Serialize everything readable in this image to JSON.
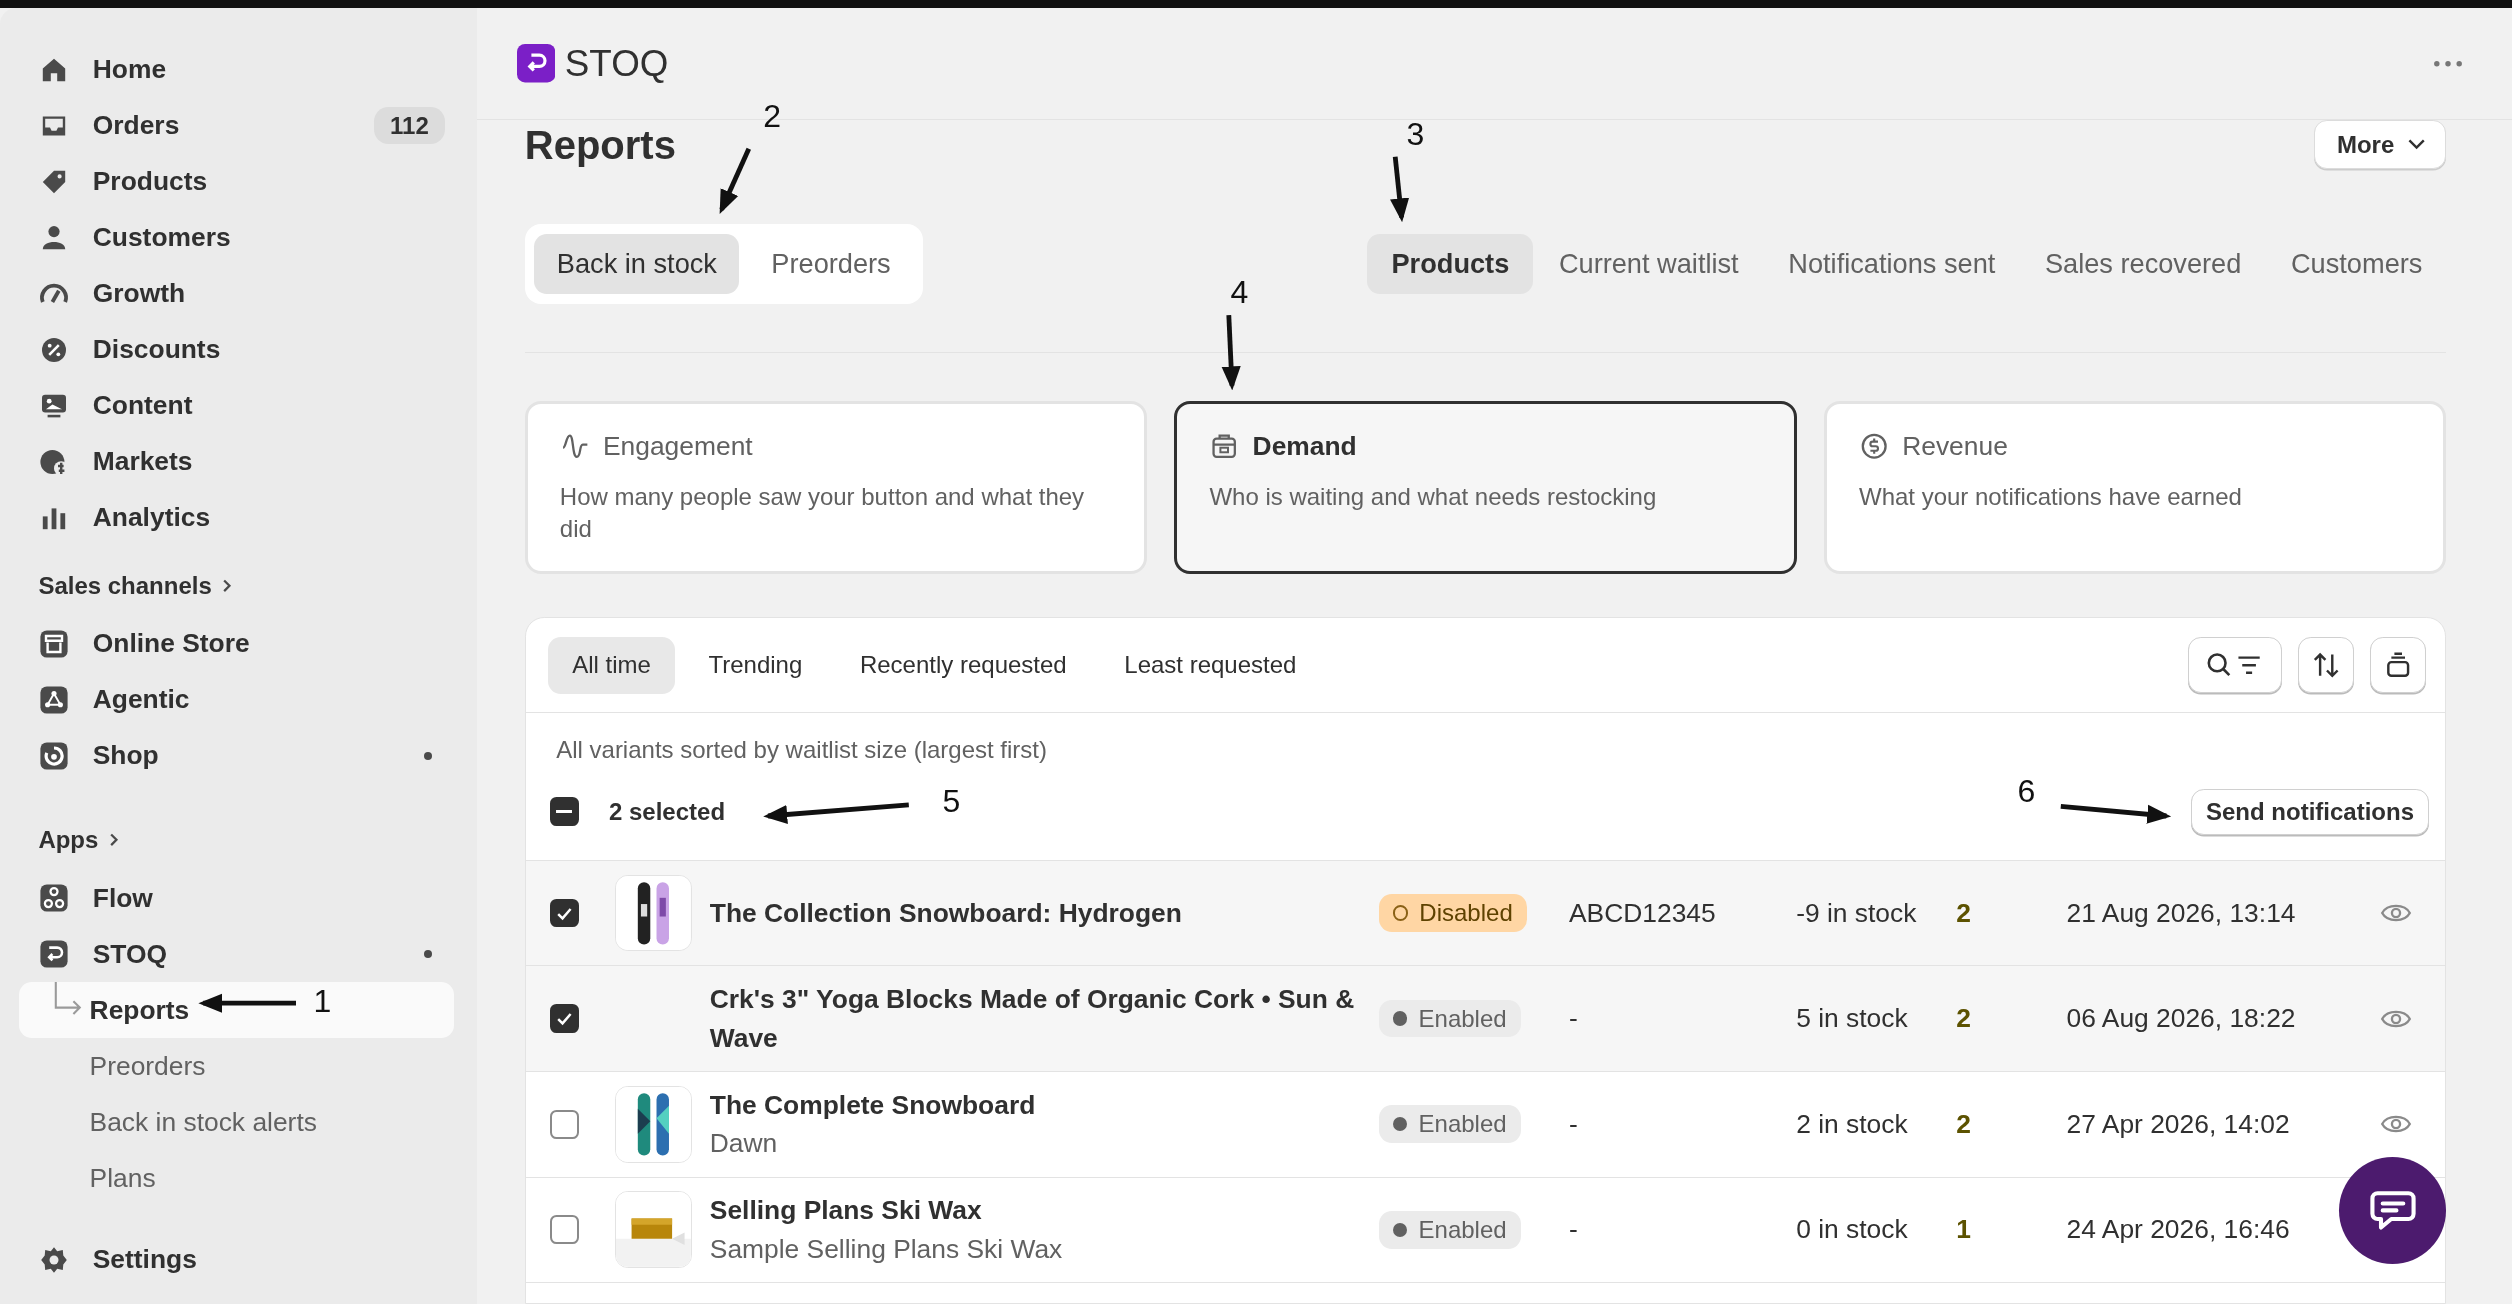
{
  "sidebar": {
    "main_items": [
      {
        "label": "Home"
      },
      {
        "label": "Orders",
        "badge": "112"
      },
      {
        "label": "Products"
      },
      {
        "label": "Customers"
      },
      {
        "label": "Growth"
      },
      {
        "label": "Discounts"
      },
      {
        "label": "Content"
      },
      {
        "label": "Markets"
      },
      {
        "label": "Analytics"
      }
    ],
    "sales_channels": {
      "heading": "Sales channels",
      "items": [
        {
          "label": "Online Store",
          "notification_dot": false
        },
        {
          "label": "Agentic",
          "notification_dot": false
        },
        {
          "label": "Shop",
          "notification_dot": true
        }
      ]
    },
    "apps": {
      "heading": "Apps",
      "items": [
        {
          "label": "Flow",
          "notification_dot": false
        },
        {
          "label": "STOQ",
          "notification_dot": true,
          "children": [
            {
              "label": "Reports",
              "selected": true
            },
            {
              "label": "Preorders",
              "selected": false
            },
            {
              "label": "Back in stock alerts",
              "selected": false
            },
            {
              "label": "Plans",
              "selected": false
            }
          ]
        }
      ]
    },
    "settings": {
      "label": "Settings"
    }
  },
  "header": {
    "app_name": "STOQ"
  },
  "page": {
    "title": "Reports",
    "more_button": "More"
  },
  "report_types": [
    {
      "label": "Back in stock",
      "selected": true
    },
    {
      "label": "Preorders",
      "selected": false
    }
  ],
  "view_tabs": [
    {
      "label": "Products",
      "selected": true
    },
    {
      "label": "Current waitlist",
      "selected": false
    },
    {
      "label": "Notifications sent",
      "selected": false
    },
    {
      "label": "Sales recovered",
      "selected": false
    },
    {
      "label": "Customers",
      "selected": false
    }
  ],
  "category_cards": [
    {
      "title": "Engagement",
      "description": "How many people saw your button and what they did",
      "selected": false
    },
    {
      "title": "Demand",
      "description": "Who is waiting and what needs restocking",
      "selected": true
    },
    {
      "title": "Revenue",
      "description": "What your notifications have earned",
      "selected": false
    }
  ],
  "table": {
    "filter_tabs": [
      {
        "label": "All time",
        "selected": true
      },
      {
        "label": "Trending",
        "selected": false
      },
      {
        "label": "Recently requested",
        "selected": false
      },
      {
        "label": "Least requested",
        "selected": false
      }
    ],
    "caption": "All variants sorted by waitlist size (largest first)",
    "selection": {
      "label": "2 selected",
      "indeterminate": true
    },
    "send_button": "Send notifications",
    "rows": [
      {
        "name": "The Collection Snowboard: Hydrogen",
        "status": {
          "label": "Disabled",
          "kind": "disabled"
        },
        "sku": "ABCD12345",
        "stock": "-9 in stock",
        "waitlist": "2",
        "date": "21 Aug 2026, 13:14",
        "selected": true
      },
      {
        "name": "Crk's 3\" Yoga Blocks Made of Organic Cork • Sun & Wave",
        "status": {
          "label": "Enabled",
          "kind": "enabled"
        },
        "sku": "-",
        "stock": "5 in stock",
        "waitlist": "2",
        "date": "06 Aug 2026, 18:22",
        "selected": true
      },
      {
        "name": "The Complete Snowboard",
        "subtitle": "Dawn",
        "status": {
          "label": "Enabled",
          "kind": "enabled"
        },
        "sku": "-",
        "stock": "2 in stock",
        "waitlist": "2",
        "date": "27 Apr 2026, 14:02",
        "selected": false
      },
      {
        "name": "Selling Plans Ski Wax",
        "subtitle": "Sample Selling Plans Ski Wax",
        "status": {
          "label": "Enabled",
          "kind": "enabled"
        },
        "sku": "-",
        "stock": "0 in stock",
        "waitlist": "1",
        "date": "24 Apr 2026, 16:46",
        "selected": false
      }
    ]
  },
  "annotations": [
    {
      "label": "1"
    },
    {
      "label": "2"
    },
    {
      "label": "3"
    },
    {
      "label": "4"
    },
    {
      "label": "5"
    },
    {
      "label": "6"
    }
  ]
}
